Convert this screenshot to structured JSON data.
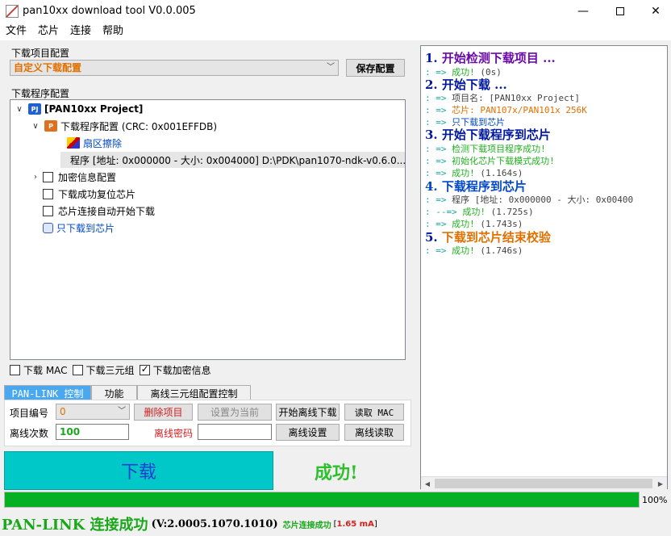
{
  "window": {
    "title": "pan10xx download tool V0.0.005",
    "min_label": "—",
    "max_label": "",
    "close_label": "✕"
  },
  "menu": [
    "文件",
    "芯片",
    "连接",
    "帮助"
  ],
  "project_config": {
    "group_label": "下载项目配置",
    "selected": "自定义下载配置",
    "save_button": "保存配置"
  },
  "program_config": {
    "group_label": "下载程序配置",
    "tree": {
      "root": "[PAN10xx Project]",
      "config_node": "下载程序配置 (CRC: 0x001EFFDB)",
      "erase": "扇区擦除",
      "program": "程序 [地址: 0x000000 - 大小: 0x004000] D:\\PDK\\pan1070-ndk-v0.6.0...",
      "encrypt": "加密信息配置",
      "reset_after": "下载成功复位芯片",
      "auto_start": "芯片连接自动开始下载",
      "only_chip": "只下载到芯片"
    }
  },
  "options": [
    {
      "label": "下载 MAC",
      "checked": false
    },
    {
      "label": "下载三元组",
      "checked": false
    },
    {
      "label": "下载加密信息",
      "checked": true
    }
  ],
  "tabs": [
    "PAN-LINK 控制",
    "功能",
    "离线三元组配置控制"
  ],
  "panlink": {
    "project_no_label": "项目编号",
    "project_no_value": "0",
    "delete_button": "删除项目",
    "set_current_button": "设置为当前",
    "start_offline_button": "开始离线下载",
    "read_mac_button": "读取 MAC",
    "offline_count_label": "离线次数",
    "offline_count_value": "100",
    "offline_password_label": "离线密码",
    "offline_password_value": "",
    "offline_settings_button": "离线设置",
    "offline_read_button": "离线读取"
  },
  "download_button": "下载",
  "result_text": "成功!",
  "log": [
    {
      "kind": "h",
      "text": "1. 开始检测下载项目 ...",
      "color": "#6a0aa8",
      "num_color": "#0018a0"
    },
    {
      "kind": "s",
      "prefix": ": => ",
      "text": "成功!",
      "suffix": "  (0s)"
    },
    {
      "kind": "h",
      "text": "2. 开始下载 ...",
      "color": "#0018a0"
    },
    {
      "kind": "s",
      "prefix": ": => ",
      "text": "项目名: [PAN10xx Project]"
    },
    {
      "kind": "s",
      "prefix": ": => ",
      "text": "芯片: PAN107x/PAN101x 256K"
    },
    {
      "kind": "s",
      "prefix": ": => ",
      "text": "只下载到芯片"
    },
    {
      "kind": "h",
      "text": "3. 开始下载程序到芯片",
      "color": "#0018a0"
    },
    {
      "kind": "s",
      "prefix": ": => ",
      "text": "检测下载项目程序成功!"
    },
    {
      "kind": "s",
      "prefix": ": => ",
      "text": "初始化芯片下载模式成功!"
    },
    {
      "kind": "s",
      "prefix": ": => ",
      "text": "成功!",
      "suffix": "  (1.164s)"
    },
    {
      "kind": "h",
      "text": "4. 下载程序到芯片",
      "color": "#0018a0"
    },
    {
      "kind": "s",
      "prefix": ": => ",
      "text": "程序 [地址: 0x000000 - 大小: 0x00400"
    },
    {
      "kind": "s",
      "prefix": ": --=> ",
      "text": "成功!",
      "suffix": "  (1.725s)"
    },
    {
      "kind": "s",
      "prefix": ": => ",
      "text": "成功!",
      "suffix": "  (1.743s)"
    },
    {
      "kind": "h",
      "text": "5. 下载到芯片结束校验",
      "color": "#e07000"
    },
    {
      "kind": "s",
      "prefix": ": => ",
      "text": "成功!",
      "suffix": "  (1.746s)"
    }
  ],
  "progress": {
    "percent": 100,
    "label": "100%"
  },
  "status": {
    "main": "PAN-LINK 连接成功",
    "version": "(V:2.0005.1070.1010)",
    "chip": "芯片连接成功",
    "current_open": "[",
    "current": "1.65 mA",
    "current_close": "]"
  },
  "colors": {
    "accent_tab": "#4aa8f0",
    "download_button": "#00c8c8",
    "success": "#20b020",
    "progress": "#06b025"
  }
}
